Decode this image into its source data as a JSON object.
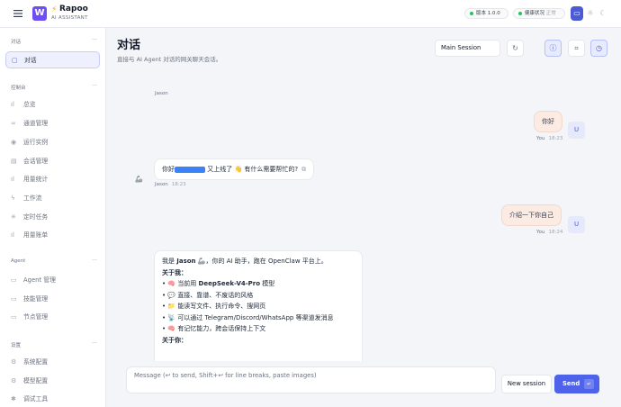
{
  "topbar": {
    "logo_letter": "W",
    "brand_name": "Rapoo",
    "brand_sub": "AI ASSISTANT",
    "version_label": "版本 1.0.0",
    "health_label": "健康状况",
    "health_status": "正常",
    "theme_icons": [
      "monitor-icon",
      "sun-icon",
      "moon-icon"
    ]
  },
  "sidebar": {
    "sections": [
      {
        "title": "对话",
        "items": [
          {
            "label": "对话",
            "icon": "chat-icon",
            "active": true
          }
        ]
      },
      {
        "title": "控制台",
        "items": [
          {
            "label": "总览",
            "icon": "bar-chart-icon"
          },
          {
            "label": "通道管理",
            "icon": "link-icon"
          },
          {
            "label": "运行实例",
            "icon": "radio-icon"
          },
          {
            "label": "会话管理",
            "icon": "file-icon"
          },
          {
            "label": "用量统计",
            "icon": "bar-chart-icon"
          },
          {
            "label": "工作流",
            "icon": "zap-icon"
          },
          {
            "label": "定时任务",
            "icon": "loader-icon"
          },
          {
            "label": "用量账单",
            "icon": "bar-chart-icon"
          }
        ]
      },
      {
        "title": "Agent",
        "items": [
          {
            "label": "Agent 管理",
            "icon": "folder-icon"
          },
          {
            "label": "技能管理",
            "icon": "folder-icon"
          },
          {
            "label": "节点管理",
            "icon": "monitor-icon"
          }
        ]
      },
      {
        "title": "设置",
        "items": [
          {
            "label": "系统配置",
            "icon": "gear-icon"
          },
          {
            "label": "模型配置",
            "icon": "gear-icon"
          },
          {
            "label": "调试工具",
            "icon": "bug-icon"
          }
        ]
      }
    ]
  },
  "main": {
    "title": "对话",
    "subtitle": "直接与 AI Agent 对话的网关聊天会话。",
    "session_select": "Main Session",
    "header_icons": [
      "refresh-icon",
      "info-icon",
      "focus-icon",
      "clock-icon"
    ]
  },
  "chat": {
    "partial_top": "Jason",
    "messages": [
      {
        "role": "user",
        "text": "你好",
        "sender": "You",
        "time": "18:23"
      },
      {
        "role": "bot",
        "text_before": "你好",
        "text_after": "又上线了 👋 有什么需要帮忙的?",
        "sender": "Jason",
        "time": "18:23"
      },
      {
        "role": "user",
        "text": "介绍一下你自己",
        "sender": "You",
        "time": "18:24"
      },
      {
        "role": "bot",
        "intro_a": "我是",
        "intro_name": "Jason",
        "intro_b": "🦾，你的 AI 助手，跑在 OpenClaw 平台上。",
        "h_about": "关于我：",
        "bullets": [
          {
            "icon": "🧠",
            "pre": "当前用",
            "bold": "DeepSeek-V4-Pro",
            "post": "模型"
          },
          {
            "icon": "💬",
            "pre": "直接、靠谱、不废话的风格",
            "bold": "",
            "post": ""
          },
          {
            "icon": "📁",
            "pre": "能读写文件、执行命令、搜网页",
            "bold": "",
            "post": ""
          },
          {
            "icon": "📡",
            "pre": "可以通过 Telegram/Discord/WhatsApp 等渠道发消息",
            "bold": "",
            "post": ""
          },
          {
            "icon": "🧠",
            "pre": "有记忆能力，跨会话保持上下文",
            "bold": "",
            "post": ""
          }
        ],
        "h_you": "关于你："
      }
    ],
    "user_avatar_label": "U"
  },
  "composer": {
    "placeholder": "Message (↩ to send, Shift+↩ for line breaks, paste images)",
    "new_session_label": "New session",
    "send_label": "Send",
    "send_kbd": "↵"
  },
  "colors": {
    "accent": "#4f63ea",
    "logo": "#6e4ff6",
    "user_bubble": "#fbebe2",
    "ok": "#22c55e"
  }
}
